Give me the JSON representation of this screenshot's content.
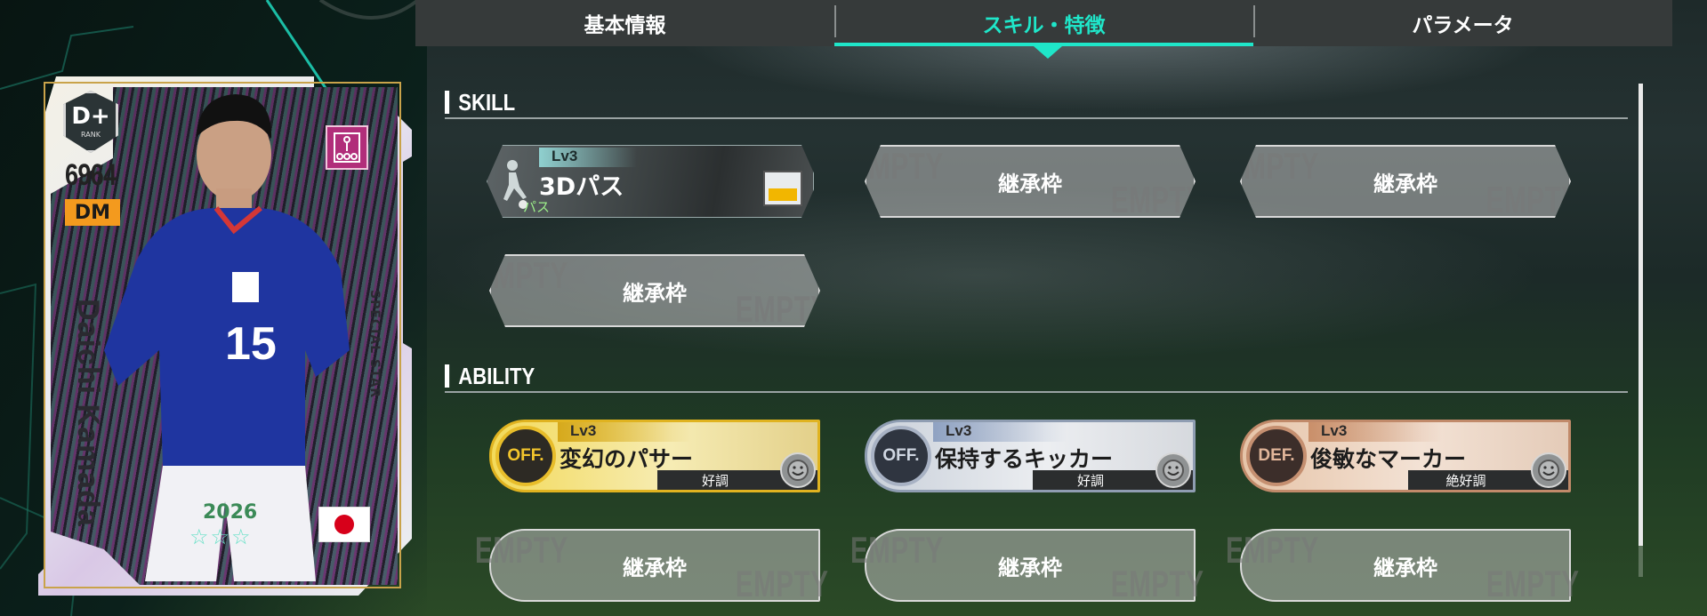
{
  "tabs": [
    {
      "label": "基本情報",
      "active": false
    },
    {
      "label": "スキル・特徴",
      "active": true
    },
    {
      "label": "パラメータ",
      "active": false
    }
  ],
  "accent_color": "#1fe6c9",
  "card": {
    "rank": "D+",
    "rank_label": "RANK",
    "rating": "6964",
    "position": "DM",
    "player_name": "Daichi Kamada",
    "card_type": "SPECIAL STAR",
    "season": "2026",
    "stars": "☆☆☆",
    "nation_icon": "japan-flag-icon",
    "role_icon": "formation-icon"
  },
  "skill_section": {
    "title": "SKILL",
    "slots": [
      {
        "type": "skill",
        "level": "Lv3",
        "name": "3Dパス",
        "category": "パス",
        "icon": "passing-player-icon",
        "position_icon": "pitch-position-icon"
      },
      {
        "type": "empty",
        "label": "継承枠",
        "watermark": "EMPTY"
      },
      {
        "type": "empty",
        "label": "継承枠",
        "watermark": "EMPTY"
      },
      {
        "type": "empty",
        "label": "継承枠",
        "watermark": "EMPTY"
      }
    ]
  },
  "ability_section": {
    "title": "ABILITY",
    "slots": [
      {
        "type": "ability",
        "tier": "gold",
        "badge": "OFF.",
        "level": "Lv3",
        "name": "変幻のパサー",
        "condition": "好調",
        "icon": "smile-face-icon"
      },
      {
        "type": "ability",
        "tier": "silver",
        "badge": "OFF.",
        "level": "Lv3",
        "name": "保持するキッカー",
        "condition": "好調",
        "icon": "smile-face-icon"
      },
      {
        "type": "ability",
        "tier": "bronze",
        "badge": "DEF.",
        "level": "Lv3",
        "name": "俊敏なマーカー",
        "condition": "絶好調",
        "icon": "smile-face-icon"
      },
      {
        "type": "empty",
        "label": "継承枠",
        "watermark": "EMPTY"
      },
      {
        "type": "empty",
        "label": "継承枠",
        "watermark": "EMPTY"
      },
      {
        "type": "empty",
        "label": "継承枠",
        "watermark": "EMPTY"
      }
    ]
  }
}
